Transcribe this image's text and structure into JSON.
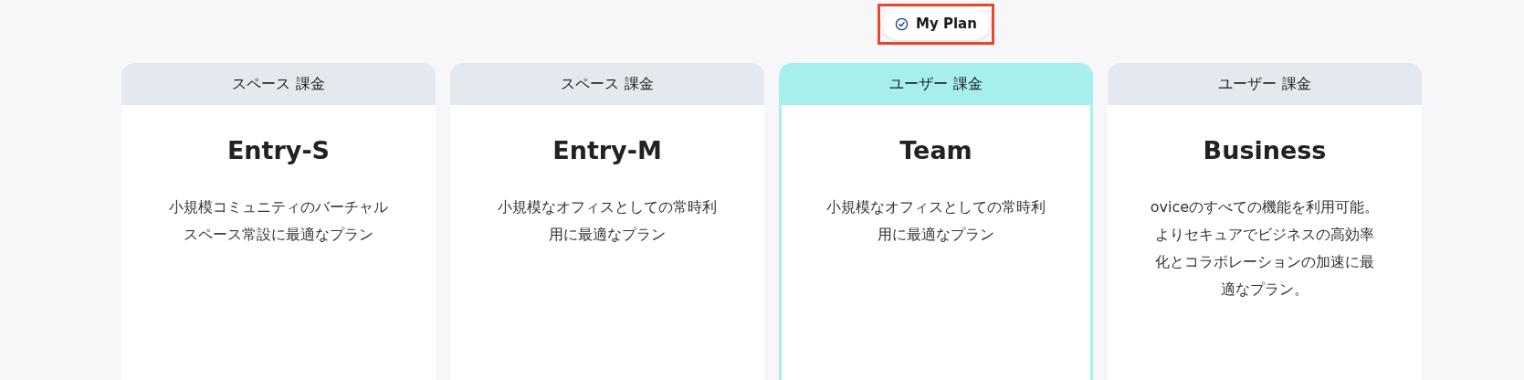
{
  "badge": {
    "label": "My Plan",
    "highlighted": true
  },
  "plans": [
    {
      "billing": "スペース 課金",
      "name": "Entry-S",
      "description": [
        "小規模コミュニティのバーチャル",
        "スペース常設に最適なプラン"
      ],
      "selected": false
    },
    {
      "billing": "スペース 課金",
      "name": "Entry-M",
      "description": [
        "小規模なオフィスとしての常時利",
        "用に最適なプラン"
      ],
      "selected": false
    },
    {
      "billing": "ユーザー 課金",
      "name": "Team",
      "description": [
        "小規模なオフィスとしての常時利",
        "用に最適なプラン"
      ],
      "selected": true
    },
    {
      "billing": "ユーザー 課金",
      "name": "Business",
      "description": [
        "oviceのすべての機能を利用可能。",
        "よりセキュアでビジネスの高効率",
        "化とコラボレーションの加速に最",
        "適なプラン。"
      ],
      "selected": false
    }
  ]
}
